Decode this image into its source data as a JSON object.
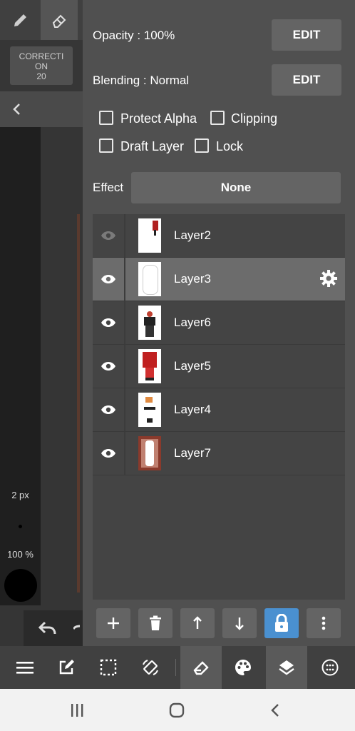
{
  "left_panel": {
    "correction_label": "CORRECTION",
    "correction_value": "20",
    "brush_size": "2 px",
    "opacity": "100 %"
  },
  "layer_props": {
    "opacity_text": "Opacity : 100%",
    "blending_text": "Blending : Normal",
    "edit_label": "EDIT",
    "protect_alpha": "Protect Alpha",
    "clipping": "Clipping",
    "draft_layer": "Draft Layer",
    "lock": "Lock",
    "effect_label": "Effect",
    "effect_value": "None"
  },
  "layers": [
    {
      "name": "Layer2",
      "visible": false,
      "selected": false
    },
    {
      "name": "Layer3",
      "visible": true,
      "selected": true
    },
    {
      "name": "Layer6",
      "visible": true,
      "selected": false
    },
    {
      "name": "Layer5",
      "visible": true,
      "selected": false
    },
    {
      "name": "Layer4",
      "visible": true,
      "selected": false
    },
    {
      "name": "Layer7",
      "visible": true,
      "selected": false
    }
  ],
  "colors": {
    "panel_bg": "#505050",
    "selected_row": "#6c6c6c",
    "lock_active": "#4a90d0"
  }
}
